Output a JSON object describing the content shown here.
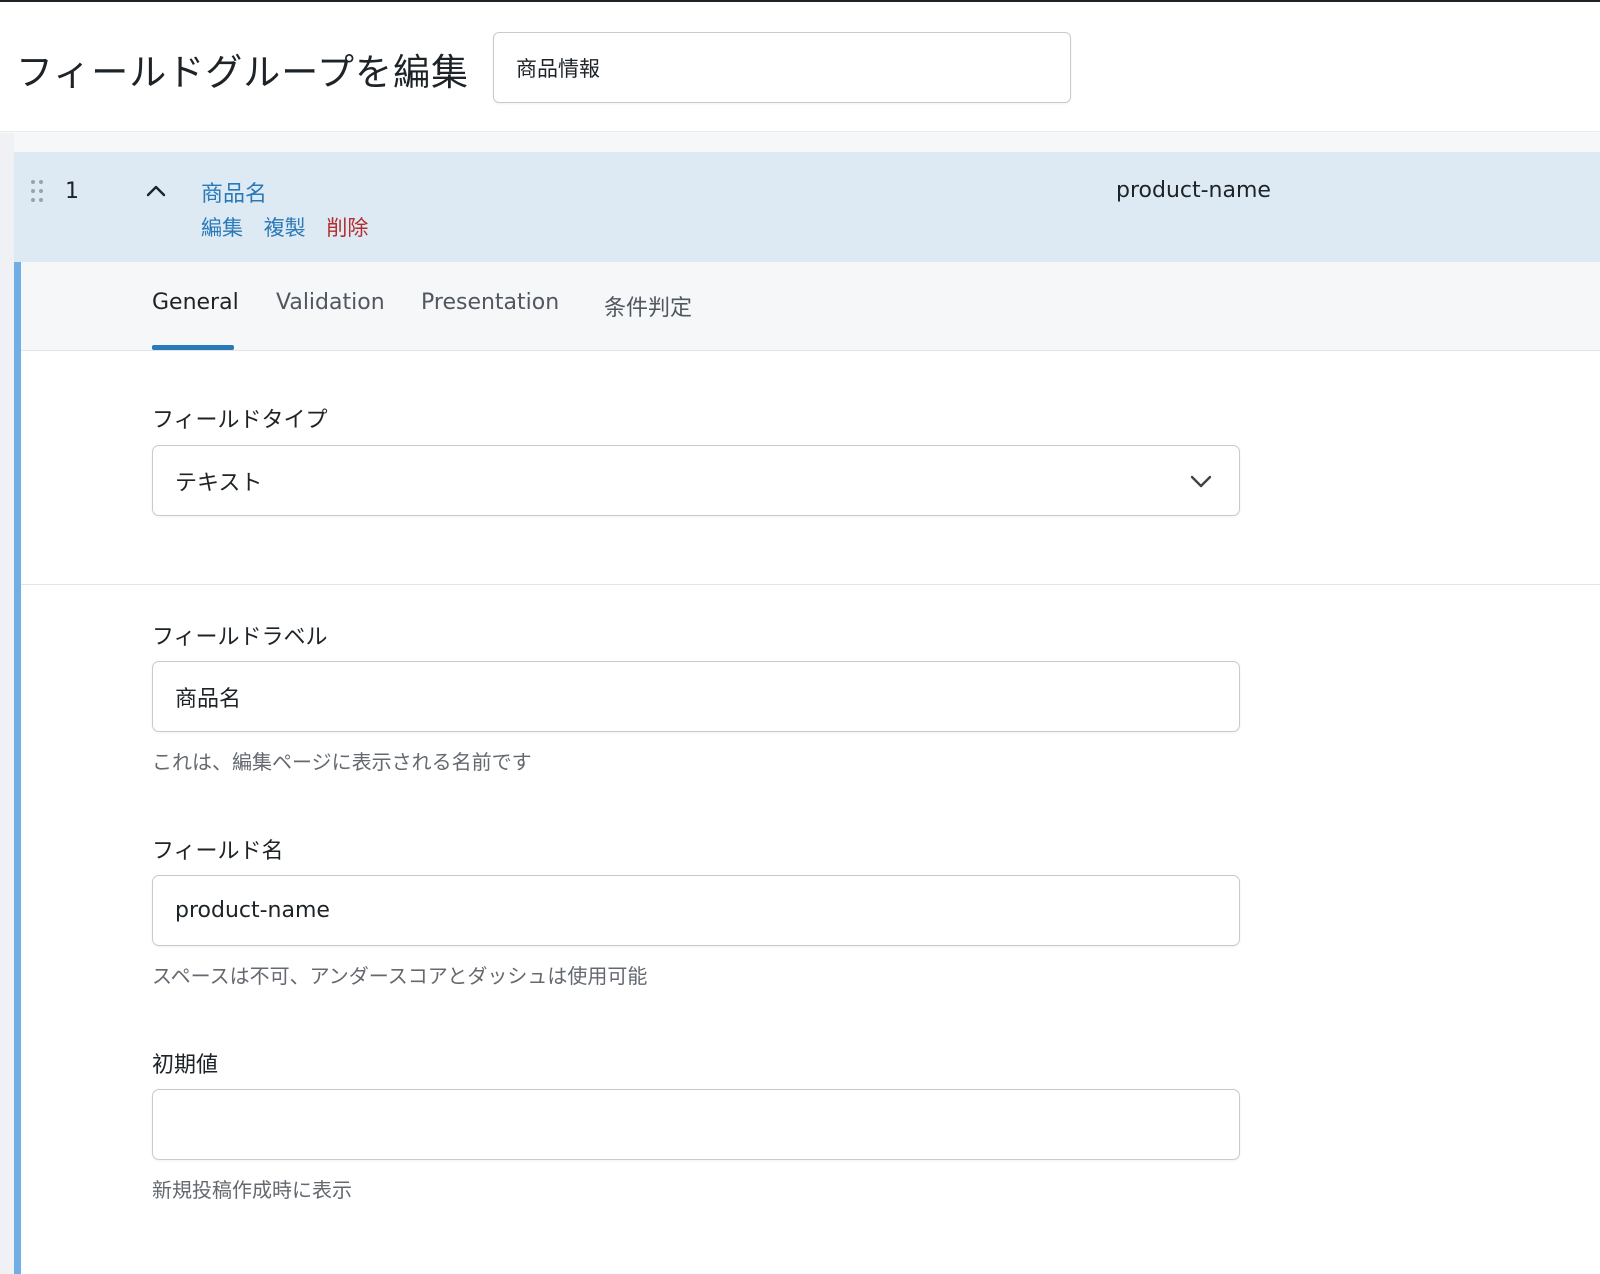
{
  "header": {
    "title": "フィールドグループを編集",
    "group_title_value": "商品情報"
  },
  "field_row": {
    "order": "1",
    "label": "商品名",
    "actions": {
      "edit": "編集",
      "duplicate": "複製",
      "delete": "削除"
    },
    "name": "product-name",
    "expanded": true
  },
  "tabs": [
    {
      "label": "General",
      "active": true
    },
    {
      "label": "Validation",
      "active": false
    },
    {
      "label": "Presentation",
      "active": false
    },
    {
      "label": "条件判定",
      "active": false
    }
  ],
  "form": {
    "field_type": {
      "label": "フィールドタイプ",
      "value": "テキスト"
    },
    "field_label": {
      "label": "フィールドラベル",
      "value": "商品名",
      "help": "これは、編集ページに表示される名前です"
    },
    "field_name": {
      "label": "フィールド名",
      "value": "product-name",
      "help": "スペースは不可、アンダースコアとダッシュは使用可能"
    },
    "default_value": {
      "label": "初期値",
      "value": "",
      "help": "新規投稿作成時に表示"
    }
  },
  "colors": {
    "accent": "#2a79b8",
    "delete": "#b32d2e",
    "row_bg": "#dde9f3",
    "panel_border": "#72aee6"
  }
}
